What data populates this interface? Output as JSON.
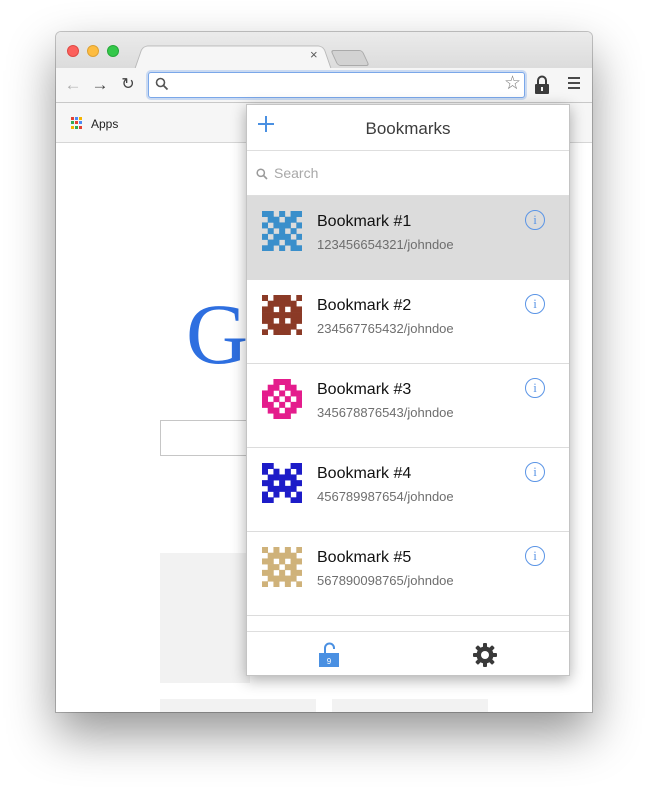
{
  "browser": {
    "tab_close_glyph": "×",
    "nav": {
      "back_glyph": "←",
      "forward_glyph": "→",
      "reload_glyph": "↻"
    },
    "address_value": "",
    "bookmarks_bar": {
      "apps_label": "Apps"
    }
  },
  "page": {
    "logo_text": "G"
  },
  "popup": {
    "title": "Bookmarks",
    "search_placeholder": "Search",
    "bookmarks": [
      {
        "title": "Bookmark #1",
        "subtitle": "123456654321/johndoe",
        "color": "#3a8fcb",
        "selected": true,
        "info_glyph": "i"
      },
      {
        "title": "Bookmark #2",
        "subtitle": "234567765432/johndoe",
        "color": "#8b3a26",
        "selected": false,
        "info_glyph": "i"
      },
      {
        "title": "Bookmark #3",
        "subtitle": "345678876543/johndoe",
        "color": "#e41c8c",
        "selected": false,
        "info_glyph": "i"
      },
      {
        "title": "Bookmark #4",
        "subtitle": "456789987654/johndoe",
        "color": "#1d1cc8",
        "selected": false,
        "info_glyph": "i"
      },
      {
        "title": "Bookmark #5",
        "subtitle": "567890098765/johndoe",
        "color": "#cfb27a",
        "selected": false,
        "info_glyph": "i"
      }
    ],
    "footer": {
      "lock_icon": "unlocked-padlock-icon",
      "settings_icon": "gear-icon"
    }
  },
  "colors": {
    "accent": "#4a90e2",
    "selected_row": "#dcdcdc",
    "google_blue": "#2e6fe0"
  }
}
